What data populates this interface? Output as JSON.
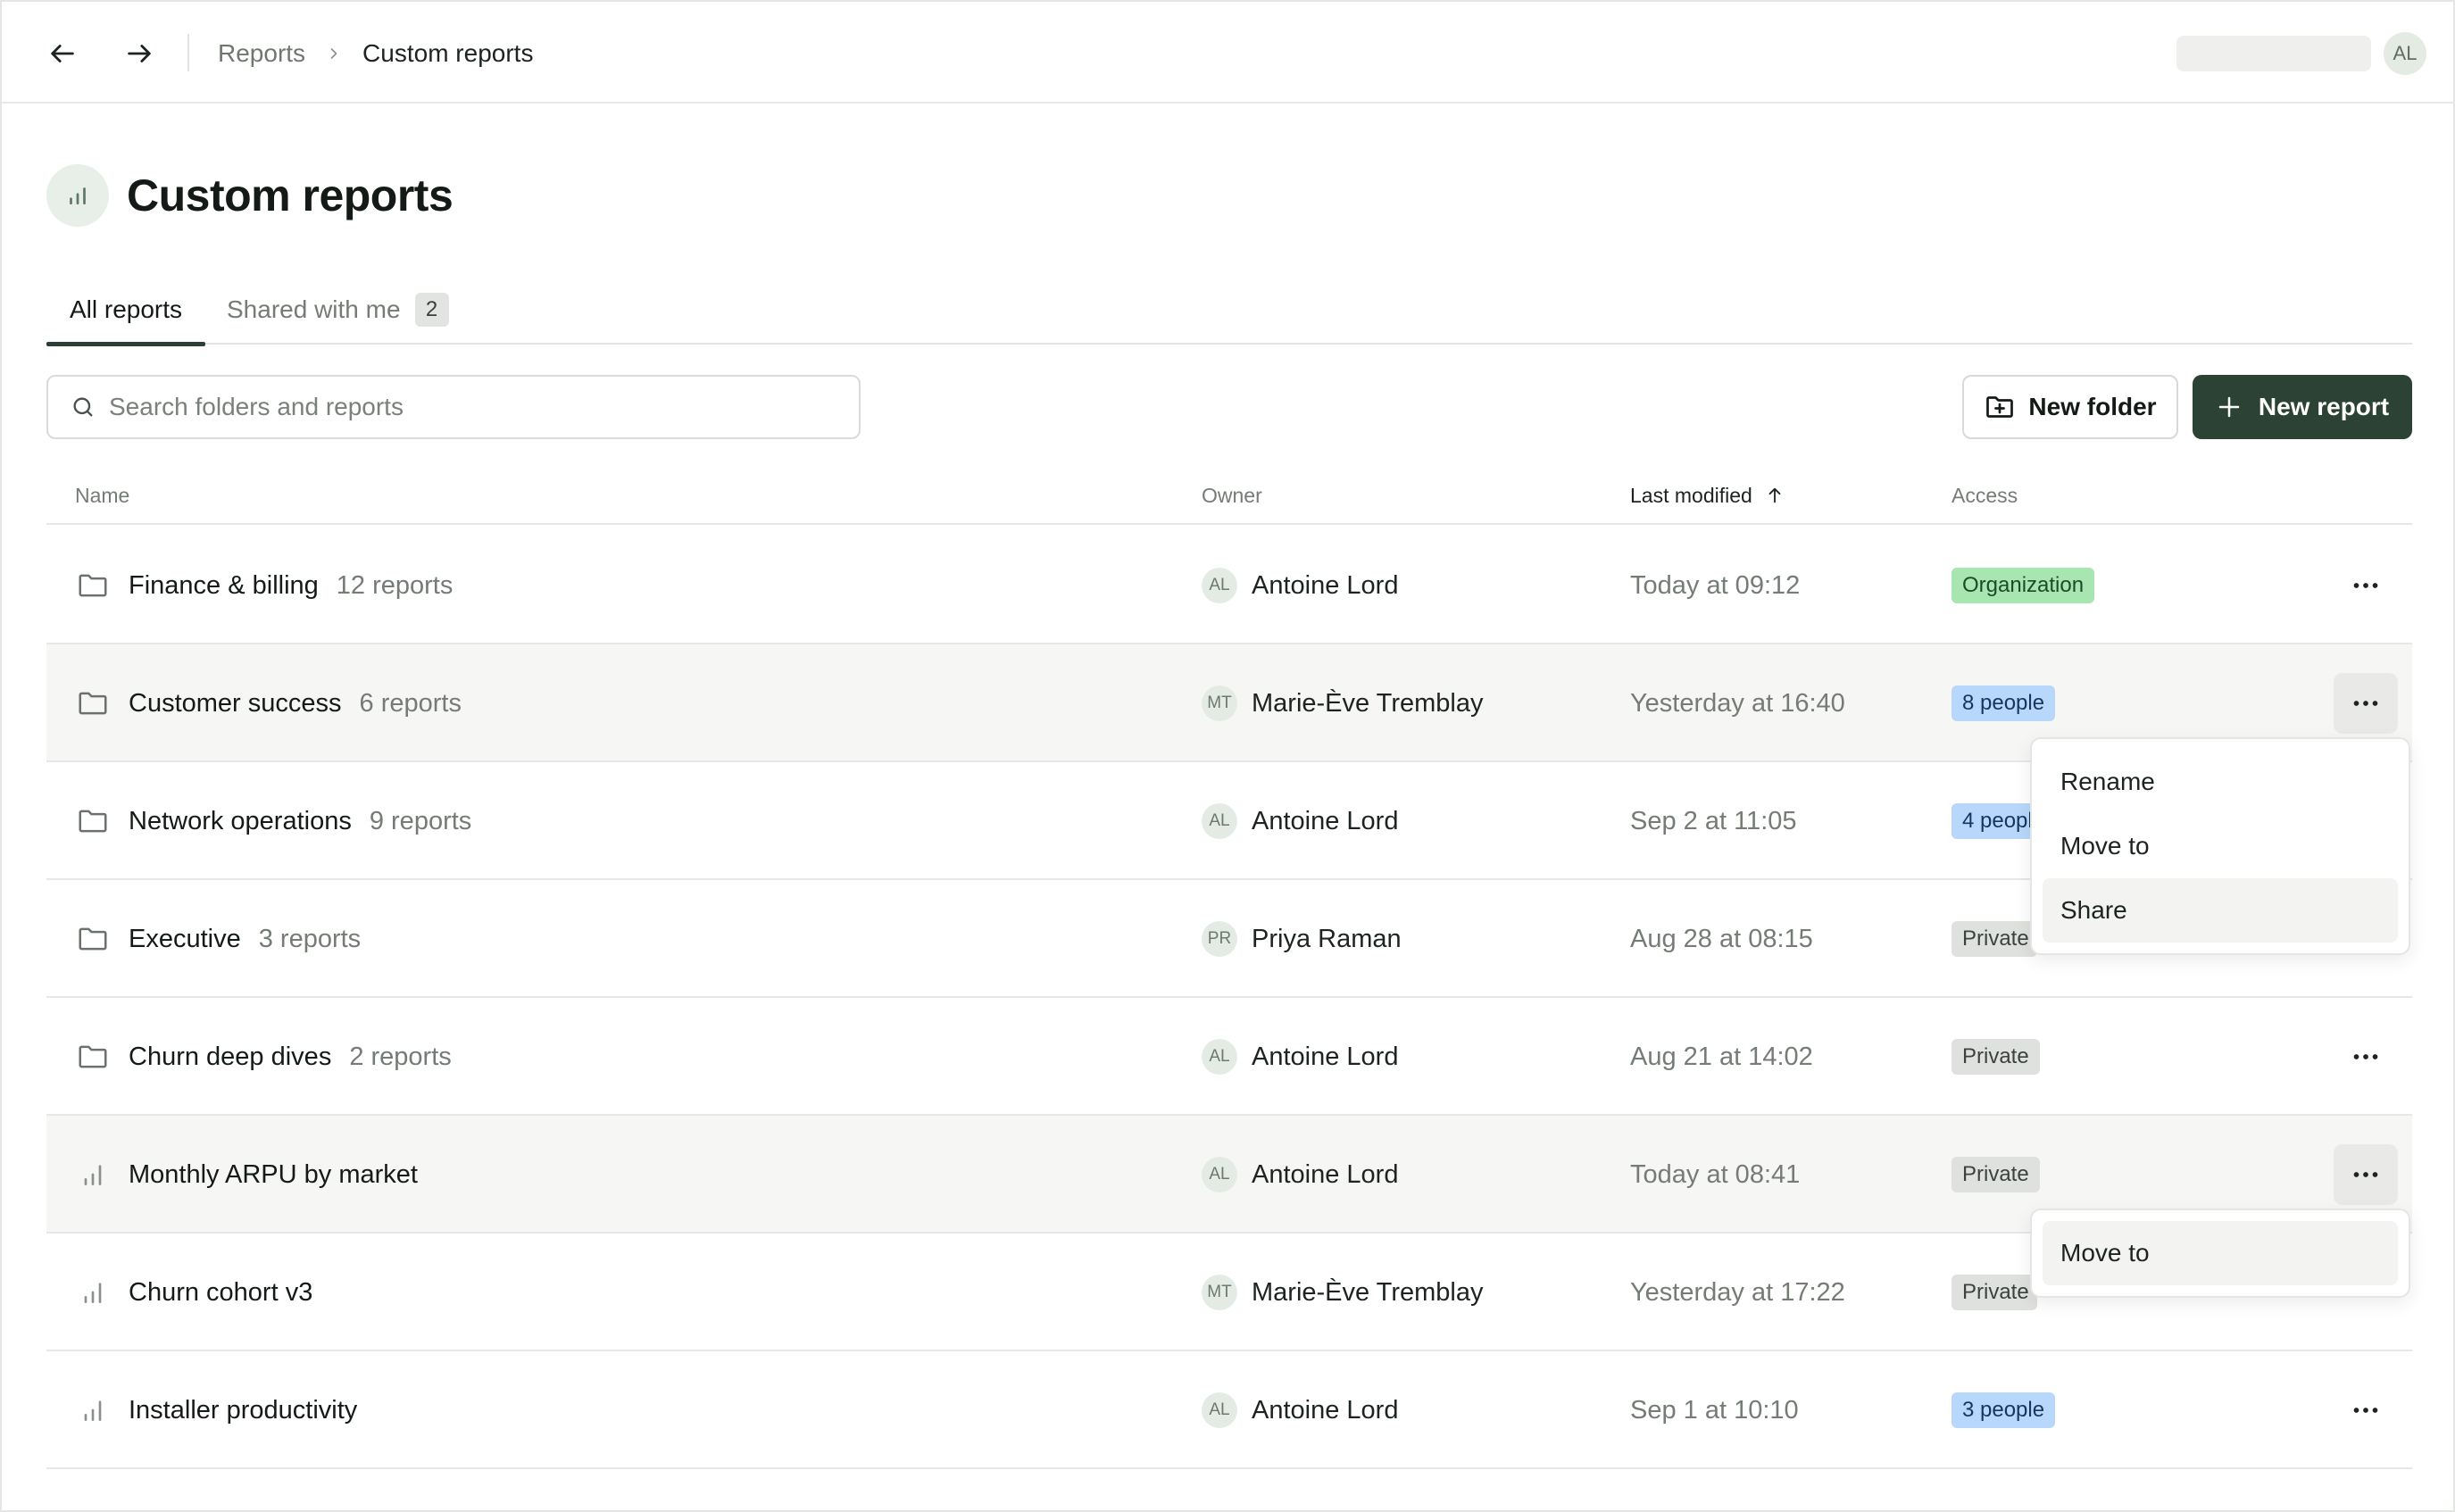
{
  "topbar": {
    "back_icon": "arrow-left-icon",
    "forward_icon": "arrow-right-icon",
    "breadcrumb": [
      "Reports",
      "Custom reports"
    ],
    "user_initials": "AL"
  },
  "header": {
    "title": "Custom reports",
    "icon": "bar-chart-icon"
  },
  "tabs": [
    {
      "label": "All reports",
      "active": true
    },
    {
      "label": "Shared with me",
      "count": "2"
    }
  ],
  "toolbar": {
    "search_placeholder": "Search folders and reports",
    "new_folder_label": "New folder",
    "new_report_label": "New report"
  },
  "table": {
    "columns": {
      "name": "Name",
      "owner": "Owner",
      "last_modified": "Last modified",
      "access": "Access"
    },
    "sorted_by": "last_modified",
    "rows": [
      {
        "type": "folder",
        "name": "Finance & billing",
        "count": "12 reports",
        "owner_initials": "AL",
        "owner": "Antoine Lord",
        "modified": "Today at 09:12",
        "access": "Organization",
        "access_kind": "org"
      },
      {
        "type": "folder",
        "name": "Customer success",
        "count": "6 reports",
        "owner_initials": "MT",
        "owner": "Marie-Ève Tremblay",
        "modified": "Yesterday at 16:40",
        "access": "8 people",
        "access_kind": "people"
      },
      {
        "type": "folder",
        "name": "Network operations",
        "count": "9 reports",
        "owner_initials": "AL",
        "owner": "Antoine Lord",
        "modified": "Sep 2 at 11:05",
        "access": "4 people",
        "access_kind": "people"
      },
      {
        "type": "folder",
        "name": "Executive",
        "count": "3 reports",
        "owner_initials": "PR",
        "owner": "Priya Raman",
        "modified": "Aug 28 at 08:15",
        "access": "Private",
        "access_kind": "private"
      },
      {
        "type": "folder",
        "name": "Churn deep dives",
        "count": "2 reports",
        "owner_initials": "AL",
        "owner": "Antoine Lord",
        "modified": "Aug 21 at 14:02",
        "access": "Private",
        "access_kind": "private"
      },
      {
        "type": "report",
        "name": "Monthly ARPU by market",
        "owner_initials": "AL",
        "owner": "Antoine Lord",
        "modified": "Today at 08:41",
        "access": "Private",
        "access_kind": "private"
      },
      {
        "type": "report",
        "name": "Churn cohort v3",
        "owner_initials": "MT",
        "owner": "Marie-Ève Tremblay",
        "modified": "Yesterday at 17:22",
        "access": "Private",
        "access_kind": "private"
      },
      {
        "type": "report",
        "name": "Installer productivity",
        "owner_initials": "AL",
        "owner": "Antoine Lord",
        "modified": "Sep 1 at 10:10",
        "access": "3 people",
        "access_kind": "people"
      }
    ]
  },
  "menus": {
    "folder_menu": [
      "Rename",
      "Move to",
      "Share"
    ],
    "folder_menu_highlighted": "Share",
    "report_menu": [
      "Move to"
    ],
    "report_menu_highlighted": "Move to"
  },
  "colors": {
    "primary": "#2b4235",
    "badge_organization": "#a7e6b0",
    "badge_people": "#b7d8fb",
    "badge_private": "#dfe1de"
  }
}
